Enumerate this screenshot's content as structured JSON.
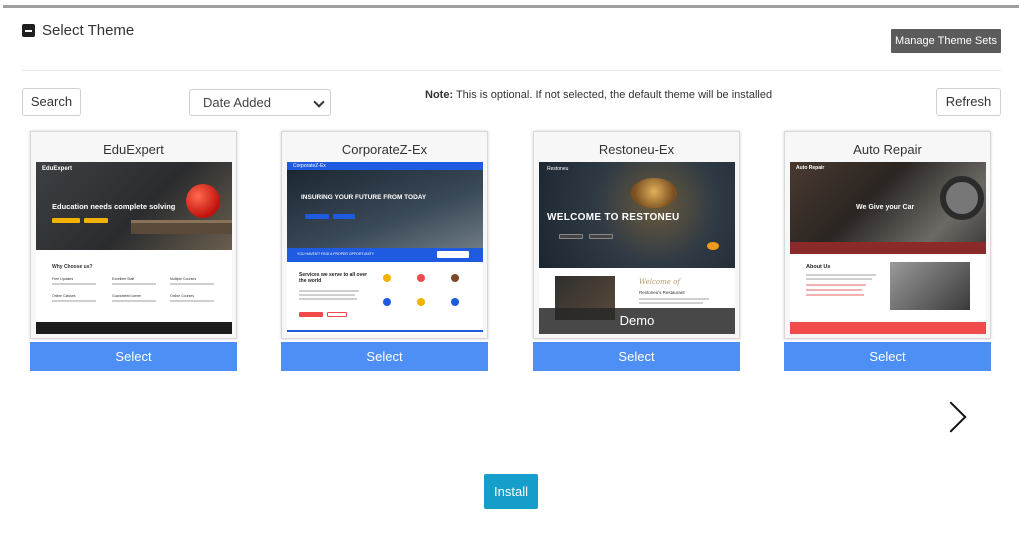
{
  "panel": {
    "title": "Select Theme",
    "collapse_icon": "minus-square-icon"
  },
  "toolbar": {
    "manage_label": "Manage Theme Sets",
    "search_label": "Search",
    "refresh_label": "Refresh",
    "sort": {
      "selected": "Date Added"
    },
    "note_bold": "Note:",
    "note_text": " This is optional. If not selected, the default theme will be installed"
  },
  "themes": [
    {
      "name": "EduExpert",
      "select_label": "Select",
      "preview": {
        "brand": "EduExpert",
        "headline": "Education needs complete solving",
        "section_heading": "Why Choose us?",
        "features": [
          "Free Updates",
          "Excellent Staff",
          "Multiple Courses",
          "Online Classes",
          "Guaranteed career",
          "Online Courses"
        ]
      }
    },
    {
      "name": "CorporateZ-Ex",
      "select_label": "Select",
      "preview": {
        "brand": "CorporateZ-Ex",
        "headline": "INSURING YOUR FUTURE FROM TODAY",
        "strip_text": "YOU HAVEN'T FIND A PROPER OPPORTUNITY",
        "section_heading": "Services we serve to all over the world"
      }
    },
    {
      "name": "Restoneu-Ex",
      "select_label": "Select",
      "demo_label": "Demo",
      "preview": {
        "brand": "Restoneu",
        "headline": "WELCOME TO RESTONEU",
        "script_text": "Welcome of",
        "section_heading": "Restoneu's Restaurant"
      }
    },
    {
      "name": "Auto Repair",
      "select_label": "Select",
      "preview": {
        "brand": "Auto Repair",
        "headline": "We Give your Car",
        "section_heading": "About Us"
      }
    }
  ],
  "navigation": {
    "next_icon": "chevron-right-icon"
  },
  "install_label": "Install",
  "colors": {
    "select_button": "#4d8ff5",
    "install_button": "#149ec9",
    "manage_button": "#5b5b5b",
    "corporate_blue": "#1e5be0",
    "auto_red": "#f04a4a",
    "edu_yellow": "#f5b100"
  }
}
